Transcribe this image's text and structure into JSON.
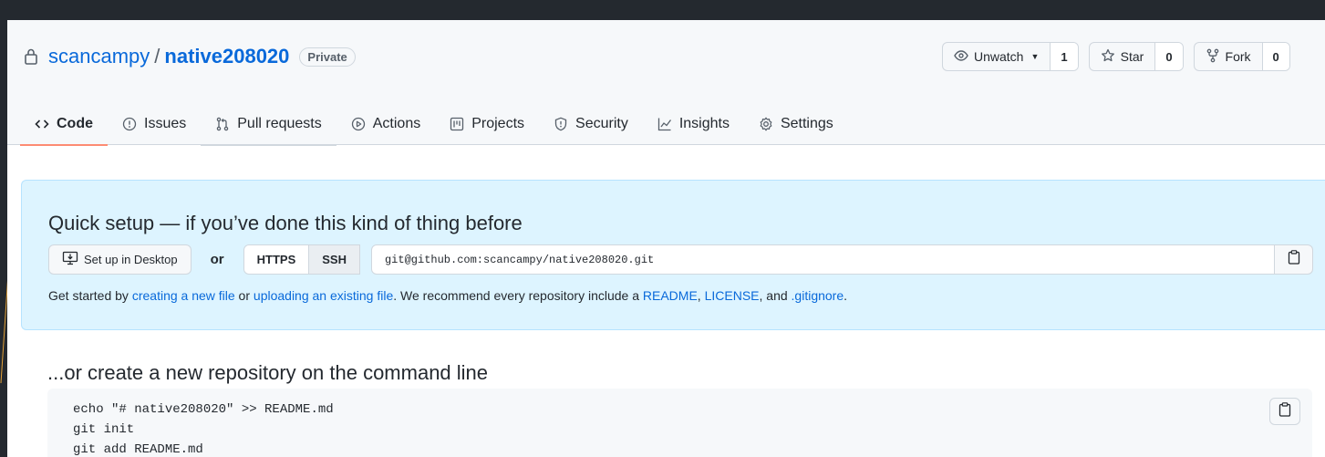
{
  "repo": {
    "owner": "scancampy",
    "separator": "/",
    "name": "native208020",
    "visibility": "Private"
  },
  "repo_actions": {
    "watch_label": "Unwatch",
    "watch_count": "1",
    "star_label": "Star",
    "star_count": "0",
    "fork_label": "Fork",
    "fork_count": "0"
  },
  "tabs": [
    {
      "label": "Code",
      "icon": "code-icon",
      "selected": true
    },
    {
      "label": "Issues",
      "icon": "issue-icon"
    },
    {
      "label": "Pull requests",
      "icon": "pull-request-icon"
    },
    {
      "label": "Actions",
      "icon": "play-icon"
    },
    {
      "label": "Projects",
      "icon": "project-icon"
    },
    {
      "label": "Security",
      "icon": "shield-icon"
    },
    {
      "label": "Insights",
      "icon": "graph-icon"
    },
    {
      "label": "Settings",
      "icon": "gear-icon"
    }
  ],
  "quick_setup": {
    "title": "Quick setup — if you’ve done this kind of thing before",
    "desktop_button": "Set up in Desktop",
    "or": "or",
    "protocols": [
      "HTTPS",
      "SSH"
    ],
    "active_protocol": "SSH",
    "clone_url": "git@github.com:scancampy/native208020.git",
    "help": {
      "prefix": "Get started by ",
      "link1": "creating a new file",
      "mid1": " or ",
      "link2": "uploading an existing file",
      "mid2": ". We recommend every repository include a ",
      "link3": "README",
      "mid3": ", ",
      "link4": "LICENSE",
      "mid4": ", and ",
      "link5": ".gitignore",
      "suffix": "."
    }
  },
  "cli": {
    "title": "...or create a new repository on the command line",
    "lines": [
      "echo \"# native208020\" >> README.md",
      "git init",
      "git add README.md"
    ]
  },
  "colors": {
    "link": "#0969da",
    "quick_setup_bg": "#ddf4ff",
    "selected_tab_underline": "#fd8c73"
  }
}
